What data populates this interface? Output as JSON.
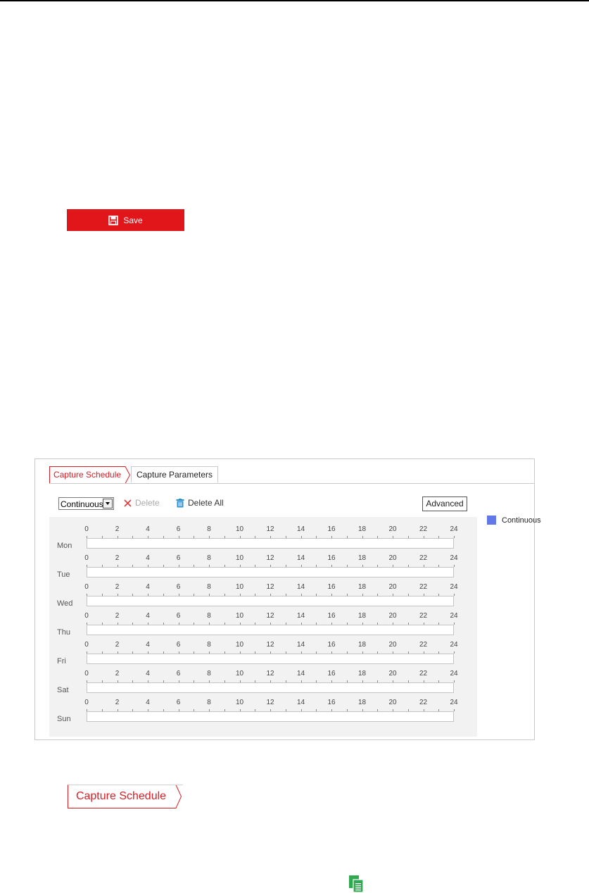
{
  "save_button": {
    "label": "Save"
  },
  "schedule_panel": {
    "tabs": [
      {
        "label": "Capture Schedule"
      },
      {
        "label": "Capture Parameters"
      }
    ],
    "toolbar": {
      "mode_select": "Continuous",
      "delete_label": "Delete",
      "delete_all_label": "Delete All",
      "advanced_label": "Advanced"
    },
    "hours": [
      "0",
      "2",
      "4",
      "6",
      "8",
      "10",
      "12",
      "14",
      "16",
      "18",
      "20",
      "22",
      "24"
    ],
    "days": [
      "Mon",
      "Tue",
      "Wed",
      "Thu",
      "Fri",
      "Sat",
      "Sun"
    ],
    "legend": {
      "label": "Continuous",
      "color": "#6278e8"
    }
  },
  "capture_schedule_tab_callout": {
    "label": "Capture Schedule"
  },
  "colors": {
    "accent_red": "#e0161b",
    "copy_icon_green": "#2fa84f"
  }
}
